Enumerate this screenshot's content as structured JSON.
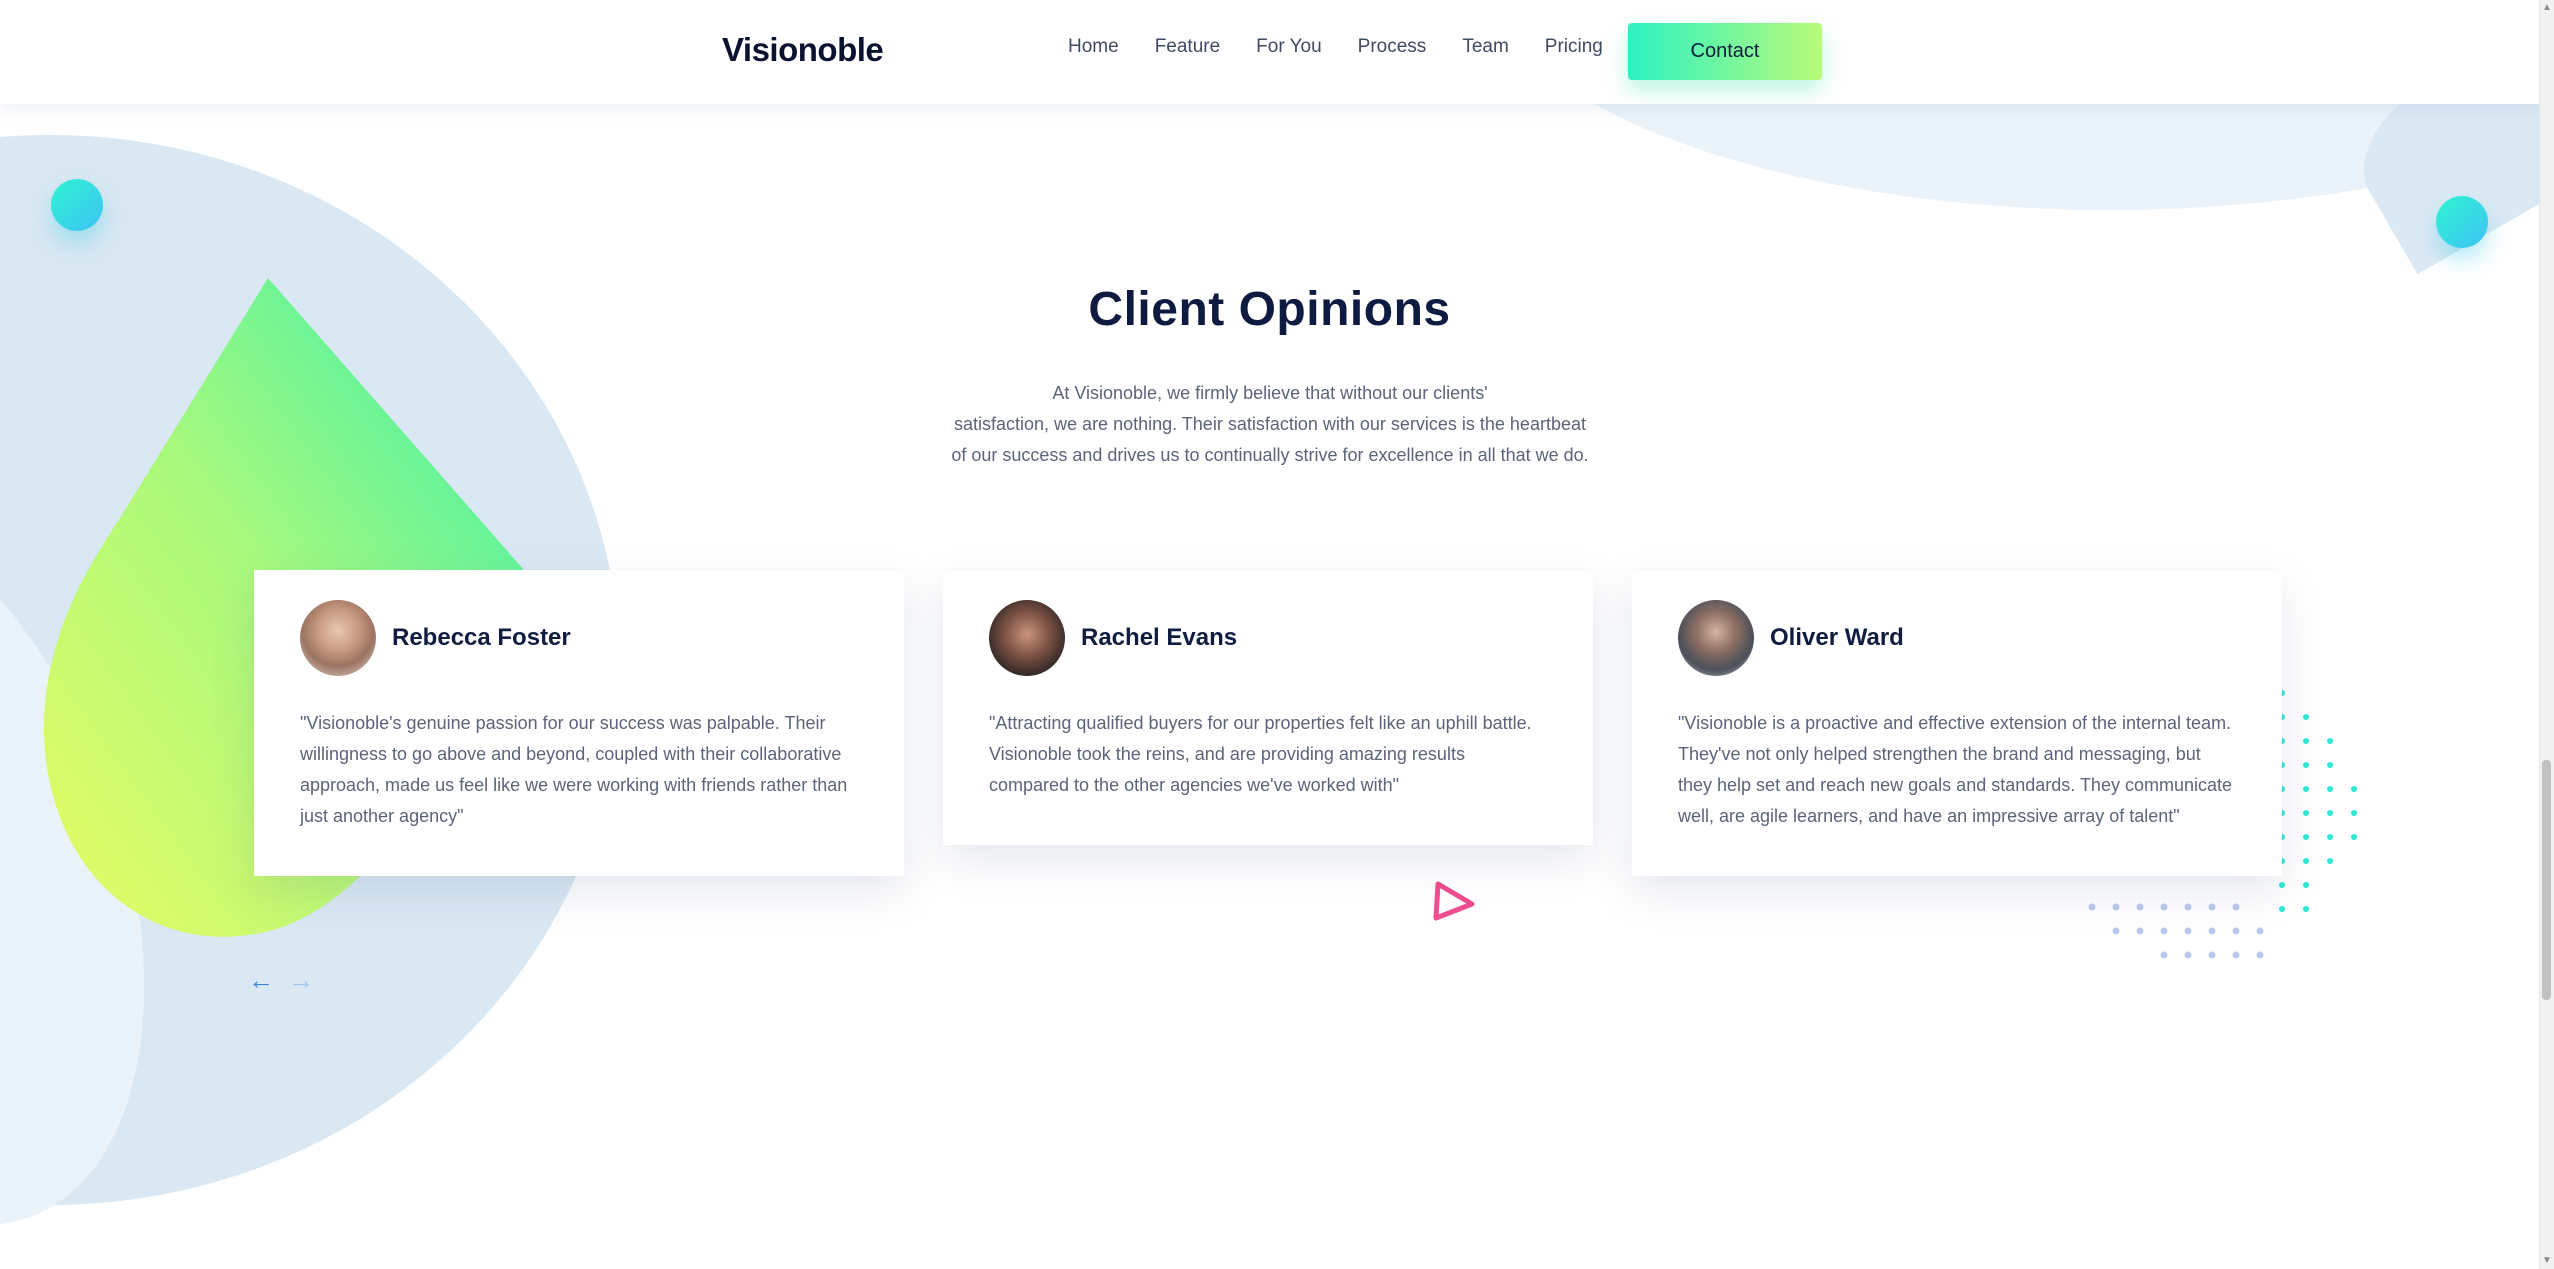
{
  "header": {
    "logo": "Visionoble",
    "nav": [
      "Home",
      "Feature",
      "For You",
      "Process",
      "Team",
      "Pricing"
    ],
    "contact_label": "Contact"
  },
  "section": {
    "title": "Client Opinions",
    "description_lines": [
      "At Visionoble, we firmly believe that without our clients'",
      "satisfaction, we are nothing. Their satisfaction with our services is the heartbeat",
      "of our success and drives us to continually strive for excellence in all that we do."
    ]
  },
  "testimonials": [
    {
      "name": "Rebecca Foster",
      "quote": "\"Visionoble's genuine passion for our success was palpable. Their willingness to go above and beyond, coupled with their collaborative approach, made us feel like we were working with friends rather than just another agency\""
    },
    {
      "name": "Rachel Evans",
      "quote": "\"Attracting qualified buyers for our properties felt like an uphill battle. Visionoble took the reins, and are providing amazing results compared to the other agencies we've worked with\""
    },
    {
      "name": "Oliver Ward",
      "quote": "\"Visionoble is a proactive and effective extension of the internal team. They've not only helped strengthen the brand and messaging, but they help set and reach new goals and standards. They communicate well, are agile learners, and have an impressive array of talent\""
    }
  ],
  "slider": {
    "prev_icon": "arrow-left-icon",
    "next_icon": "arrow-right-icon"
  },
  "colors": {
    "accent_start": "#2cf2c2",
    "accent_end": "#b8fb7a",
    "heading": "#0e1a3f",
    "body_text": "#5b6479",
    "pink": "#ee4d8f",
    "arrow_active": "#3b86d6"
  }
}
